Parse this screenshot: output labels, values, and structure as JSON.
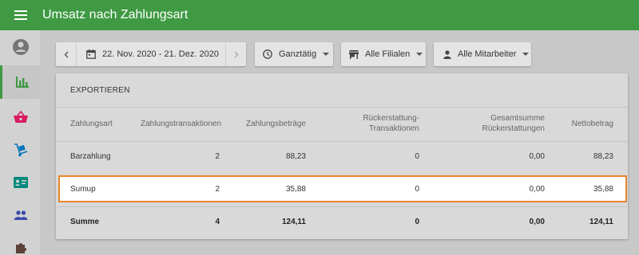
{
  "topbar": {
    "title": "Umsatz nach Zahlungsart",
    "menu_icon": "menu-icon"
  },
  "sidebar": {
    "items": [
      {
        "name": "account",
        "icon": "account-circle-icon",
        "color": "#757575"
      },
      {
        "name": "reports",
        "icon": "bar-chart-icon",
        "color": "#3f9a43",
        "active": true
      },
      {
        "name": "sales",
        "icon": "shopping-basket-icon",
        "color": "#d81b60"
      },
      {
        "name": "products",
        "icon": "dolly-icon",
        "color": "#0277bd"
      },
      {
        "name": "customers",
        "icon": "contact-card-icon",
        "color": "#00897b"
      },
      {
        "name": "employees",
        "icon": "people-icon",
        "color": "#3949ab"
      },
      {
        "name": "extensions",
        "icon": "puzzle-icon",
        "color": "#5d4037"
      }
    ]
  },
  "toolbar": {
    "date_range": "22. Nov. 2020 - 21. Dez. 2020",
    "time_filter": "Ganztätig",
    "branch_filter": "Alle Filialen",
    "employee_filter": "Alle Mitarbeiter"
  },
  "card": {
    "export_label": "EXPORTIEREN",
    "columns": {
      "payment_method": "Zahlungsart",
      "transactions_line": "Zahlungstransaktionen",
      "amounts": "Zahlungsbeträge",
      "refund_tx_1": "Rückerstattung-",
      "refund_tx_2": "Transaktionen",
      "refund_total_1": "Gesamtsumme",
      "refund_total_2": "Rückerstattungen",
      "net": "Nettobetrag"
    },
    "rows": [
      {
        "method": "Barzahlung",
        "transactions": "2",
        "amount": "88,23",
        "refund_tx": "0",
        "refund_total": "0,00",
        "net": "88,23"
      },
      {
        "method": "Sumup",
        "transactions": "2",
        "amount": "35,88",
        "refund_tx": "0",
        "refund_total": "0,00",
        "net": "35,88"
      }
    ],
    "total": {
      "label": "Summe",
      "transactions": "4",
      "amount": "124,11",
      "refund_tx": "0",
      "refund_total": "0,00",
      "net": "124,11"
    }
  },
  "colors": {
    "brand": "#3f9a43",
    "highlight": "#e8842c"
  }
}
